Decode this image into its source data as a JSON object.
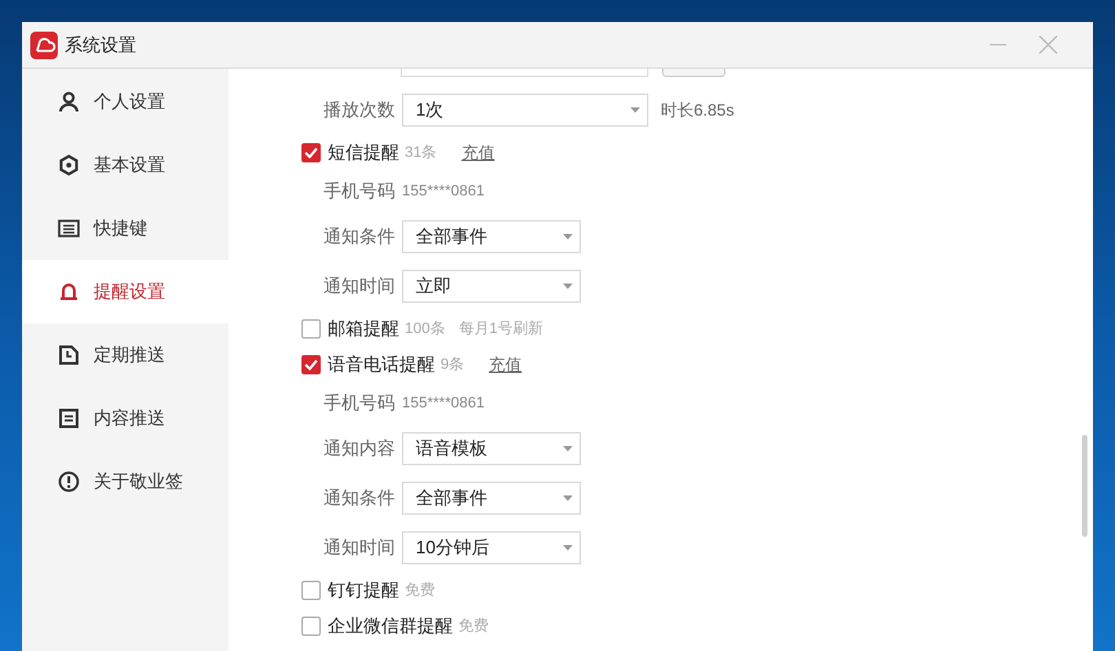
{
  "window": {
    "title": "系统设置"
  },
  "sidebar": {
    "items": [
      {
        "label": "个人设置",
        "selected": false
      },
      {
        "label": "基本设置",
        "selected": false
      },
      {
        "label": "快捷键",
        "selected": false
      },
      {
        "label": "提醒设置",
        "selected": true
      },
      {
        "label": "定期推送",
        "selected": false
      },
      {
        "label": "内容推送",
        "selected": false
      },
      {
        "label": "关于敬业签",
        "selected": false
      }
    ]
  },
  "content": {
    "rows": [
      {
        "kind": "cutoff"
      },
      {
        "kind": "select",
        "label": "播放次数",
        "value": "1次",
        "note": "时长6.85s"
      },
      {
        "kind": "checkbox",
        "label": "短信提醒",
        "checked": true,
        "note": "31条",
        "link": "充值"
      },
      {
        "kind": "info",
        "label": "手机号码",
        "value": "155****0861"
      },
      {
        "kind": "select",
        "label": "通知条件",
        "value": "全部事件"
      },
      {
        "kind": "select",
        "label": "通知时间",
        "value": "立即"
      },
      {
        "kind": "checkbox",
        "label": "邮箱提醒",
        "checked": false,
        "note": "100条",
        "extra": "每月1号刷新"
      },
      {
        "kind": "checkbox",
        "label": "语音电话提醒",
        "checked": true,
        "note": "9条",
        "link": "充值"
      },
      {
        "kind": "info",
        "label": "手机号码",
        "value": "155****0861"
      },
      {
        "kind": "select",
        "label": "通知内容",
        "value": "语音模板"
      },
      {
        "kind": "select",
        "label": "通知条件",
        "value": "全部事件"
      },
      {
        "kind": "select",
        "label": "通知时间",
        "value": "10分钟后"
      },
      {
        "kind": "checkbox",
        "label": "钉钉提醒",
        "checked": false,
        "note": "免费"
      },
      {
        "kind": "checkbox",
        "label": "企业微信群提醒",
        "checked": false,
        "note": "免费"
      }
    ]
  }
}
